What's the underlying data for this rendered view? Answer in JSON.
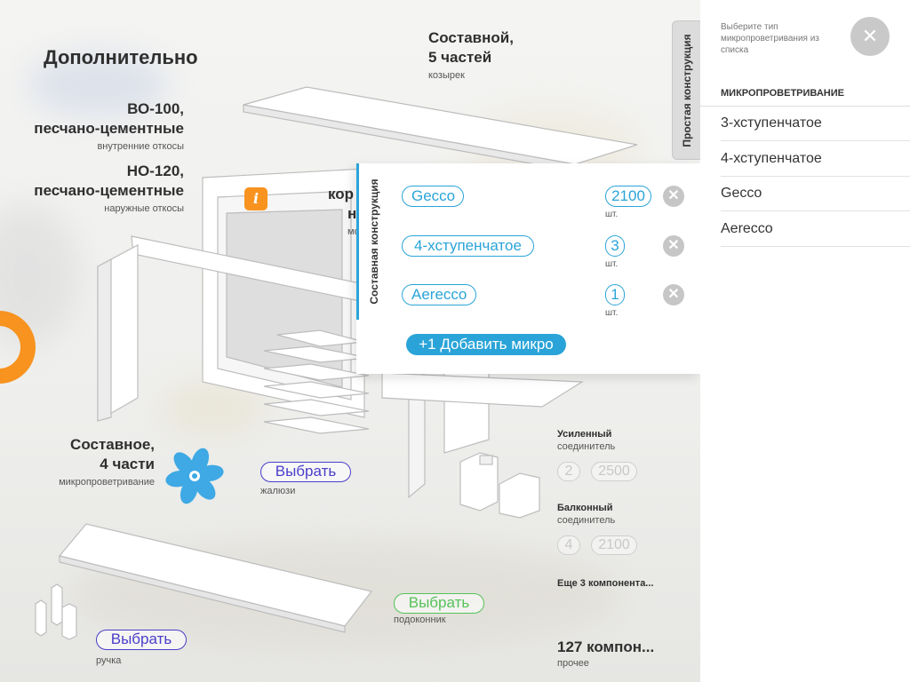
{
  "title": "Дополнительно",
  "labels": {
    "visor": {
      "big1": "Составной,",
      "big2": "5 частей",
      "small": "козырек"
    },
    "inner_slopes": {
      "big1": "ВО-100,",
      "big2": "песчано-цементные",
      "small": "внутренние откосы"
    },
    "outer_slopes": {
      "big1": "НО-120,",
      "big2": "песчано-цементные",
      "small": "наружные откосы"
    },
    "partial_big1": "кор",
    "partial_big2": "н",
    "partial_small": "мо",
    "micro": {
      "big1": "Составное,",
      "big2": "4 части",
      "small": "микропроветривание"
    },
    "reinforced": {
      "big": "Усиленный",
      "small": "соединитель",
      "qty": "2",
      "size": "2500"
    },
    "balcony": {
      "big": "Балконный",
      "small": "соединитель",
      "qty": "4",
      "size": "2100"
    },
    "more": "Еще 3 компонента...",
    "total": {
      "big": "127 компон...",
      "small": "прочее"
    }
  },
  "buttons": {
    "blinds": {
      "label": "Выбрать",
      "caption": "жалюзи"
    },
    "sill": {
      "label": "Выбрать",
      "caption": "подоконник"
    },
    "handle": {
      "label": "Выбрать",
      "caption": "ручка"
    }
  },
  "tab_simple": "Простая конструкция",
  "composite": {
    "tab_label": "Составная конструкция",
    "rows": [
      {
        "name": "Gecco",
        "qty": "2100",
        "unit": "шт."
      },
      {
        "name": "4-хступенчатое",
        "qty": "3",
        "unit": "шт."
      },
      {
        "name": "Aerecco",
        "qty": "1",
        "unit": "шт."
      }
    ],
    "add_label": "+1 Добавить микро",
    "remove_glyph": "✕"
  },
  "sidebar": {
    "hint": "Выберите тип микропроветривания из списка",
    "close_glyph": "✕",
    "header": "МИКРОПРОВЕТРИВАНИЕ",
    "items": [
      "3-хступенчатое",
      "4-хступенчатое",
      "Gecco",
      "Aerecco"
    ]
  },
  "info_glyph": "i",
  "colors": {
    "accent_blue": "#2aa4d8",
    "orange": "#f7931e",
    "violet": "#4a3ec9",
    "green": "#55c25a"
  }
}
